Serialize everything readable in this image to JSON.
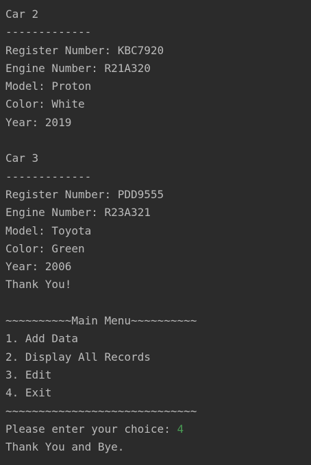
{
  "colors": {
    "background": "#2b2b2b",
    "text": "#bbbbbb",
    "user_input": "#499c54"
  },
  "console": {
    "car2": {
      "title": "Car 2",
      "separator": "-------------",
      "register": "Register Number: KBC7920",
      "engine": "Engine Number: R21A320",
      "model": "Model: Proton",
      "color": "Color: White",
      "year": "Year: 2019"
    },
    "car3": {
      "title": "Car 3",
      "separator": "-------------",
      "register": "Register Number: PDD9555",
      "engine": "Engine Number: R23A321",
      "model": "Model: Toyota",
      "color": "Color: Green",
      "year": "Year: 2006"
    },
    "thank_you": "Thank You!",
    "menu": {
      "header": "~~~~~~~~~~Main Menu~~~~~~~~~~",
      "items": [
        "1. Add Data",
        "2. Display All Records",
        "3. Edit",
        "4. Exit"
      ],
      "footer": "~~~~~~~~~~~~~~~~~~~~~~~~~~~~~"
    },
    "prompt": "Please enter your choice: ",
    "user_choice": "4",
    "goodbye": "Thank You and Bye."
  }
}
